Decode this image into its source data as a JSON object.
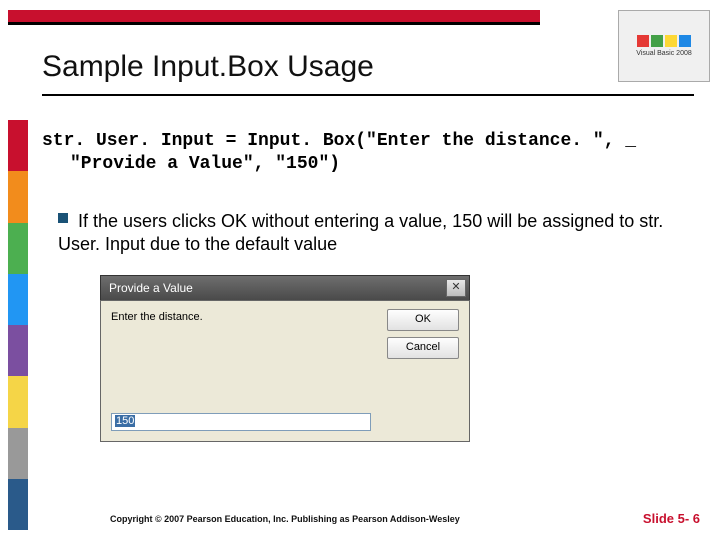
{
  "header": {
    "title": "Sample Input.Box Usage",
    "logo_text": "Visual Basic 2008"
  },
  "code": {
    "line1": "str. User. Input = Input. Box(\"Enter the distance. \", _",
    "line2": "\"Provide a Value\", \"150\")"
  },
  "bullet": {
    "text": "If the users clicks OK without entering a value, 150 will be assigned to str. User. Input due to the default value"
  },
  "dialog": {
    "title": "Provide a Value",
    "prompt": "Enter the distance.",
    "value": "150",
    "ok_label": "OK",
    "cancel_label": "Cancel",
    "close_glyph": "✕"
  },
  "footer": {
    "copyright": "Copyright © 2007 Pearson Education, Inc. Publishing as Pearson Addison-Wesley",
    "slide": "Slide 5- 6"
  }
}
